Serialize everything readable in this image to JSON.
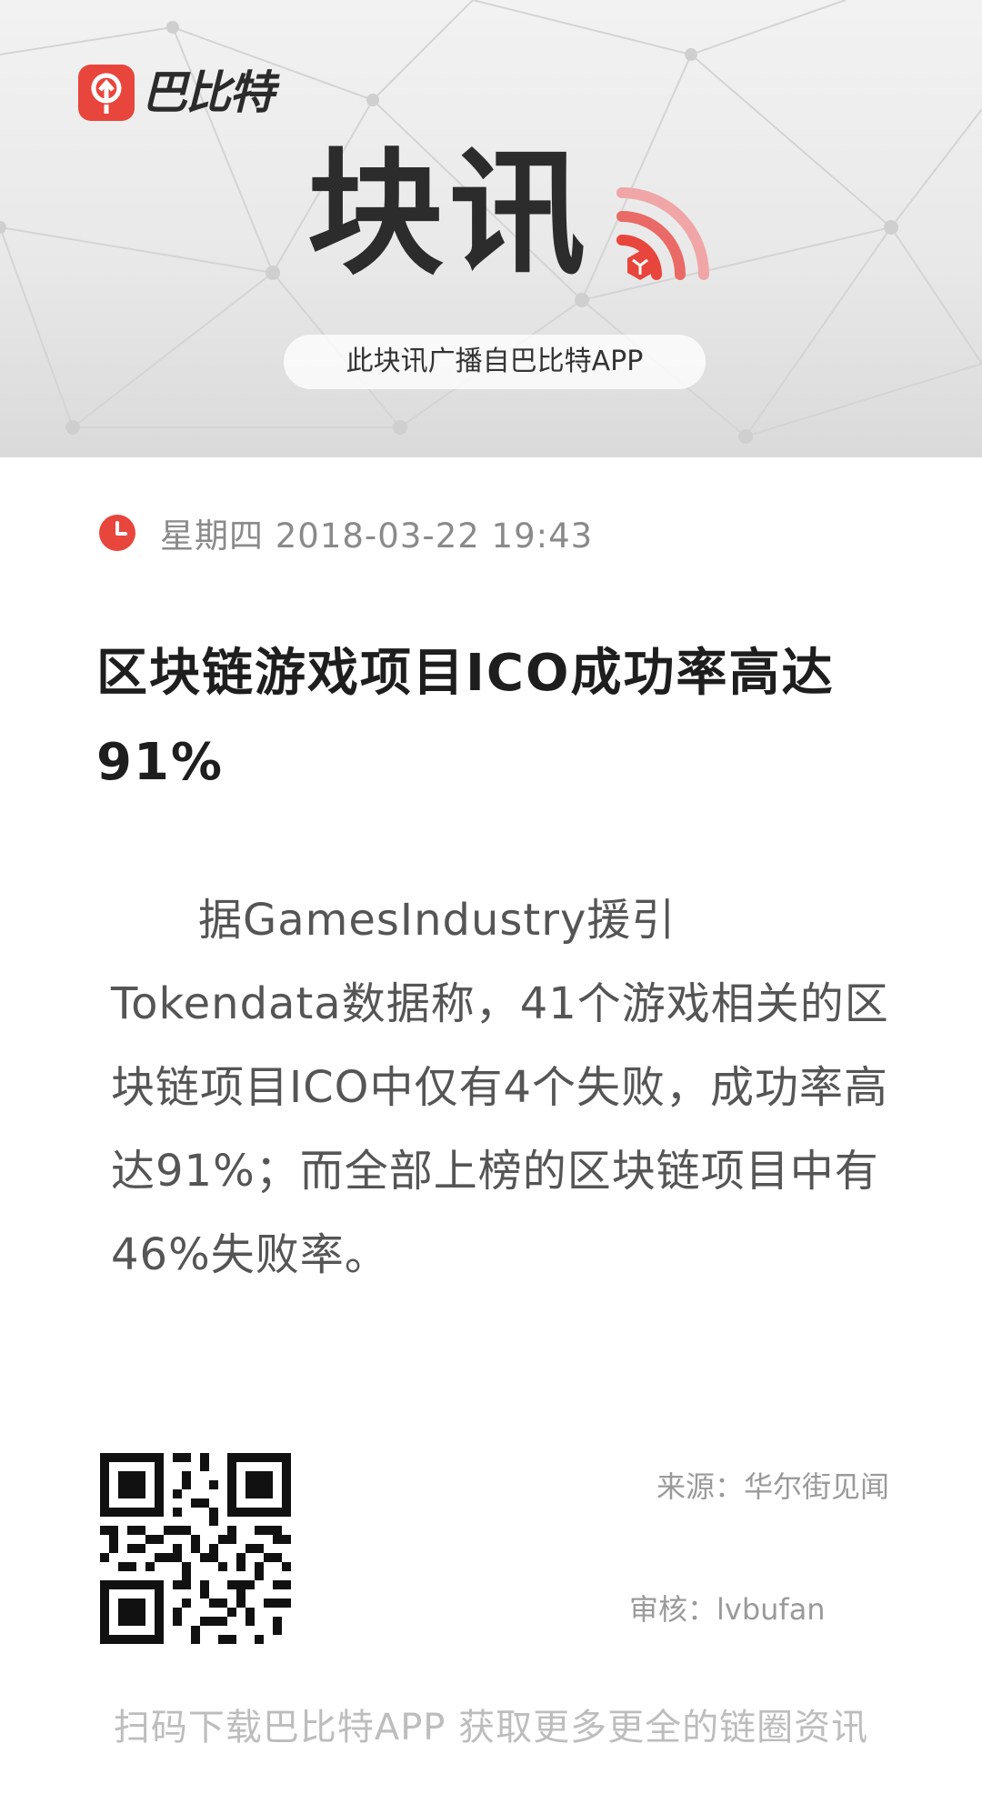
{
  "banner": {
    "logo_text": "巴比特",
    "headline": "块讯",
    "broadcast_label": "此块讯广播自巴比特APP"
  },
  "article": {
    "date": "星期四 2018-03-22 19:43",
    "title": "区块链游戏项目ICO成功率高达91%",
    "body": "据GamesIndustry援引Tokendata数据称，41个游戏相关的区块链项目ICO中仅有4个失败，成功率高达91%；而全部上榜的区块链项目中有46%失败率。"
  },
  "footer": {
    "source": "来源：华尔街见闻",
    "reviewer": "审核：lvbufan",
    "cta": "扫码下载巴比特APP 获取更多更全的链圈资讯"
  },
  "colors": {
    "brand_red": "#e8453c",
    "title_text": "#1e1e1e",
    "body_text": "#555555",
    "meta_text": "#9a9a9a"
  },
  "icons": {
    "logo": "babite-logo-icon",
    "signal": "broadcast-wave-icon",
    "clock": "clock-icon",
    "qr": "qr-code-icon"
  }
}
